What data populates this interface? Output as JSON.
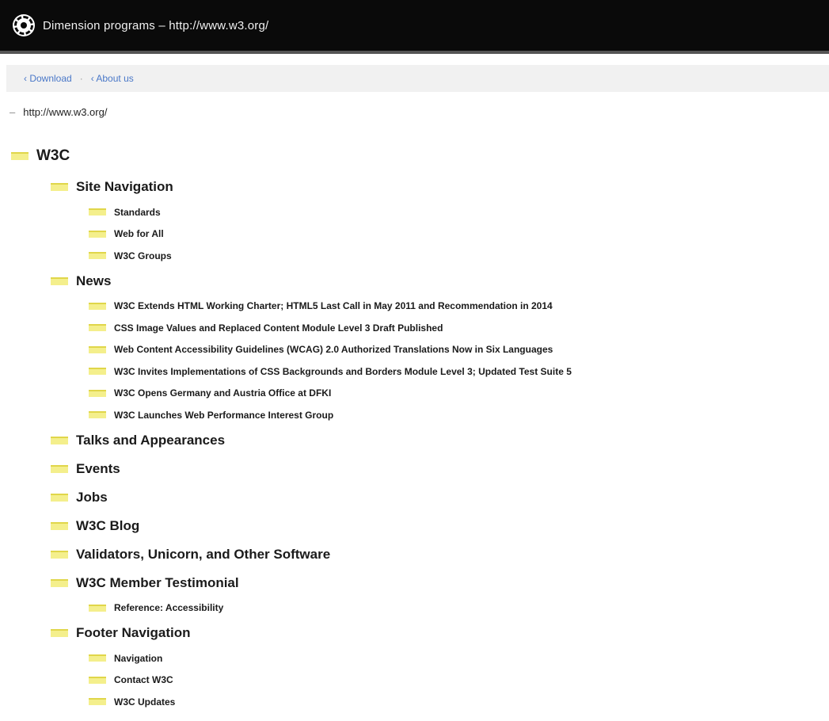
{
  "window": {
    "title": "Dimension programs – http://www.w3.org/"
  },
  "nav": {
    "download": "‹ Download",
    "sep": "·",
    "about": "‹ About us"
  },
  "page": {
    "url": "http://www.w3.org/"
  },
  "tree": [
    {
      "level": 0,
      "label": "W3C"
    },
    {
      "level": 1,
      "label": "Site Navigation"
    },
    {
      "level": 2,
      "label": "Standards"
    },
    {
      "level": 2,
      "label": "Web for All"
    },
    {
      "level": 2,
      "label": "W3C Groups"
    },
    {
      "level": 1,
      "label": "News"
    },
    {
      "level": 2,
      "label": "W3C Extends HTML Working Charter; HTML5 Last Call in May 2011 and Recommendation in 2014"
    },
    {
      "level": 2,
      "label": "CSS Image Values and Replaced Content Module Level 3 Draft Published"
    },
    {
      "level": 2,
      "label": "Web Content Accessibility Guidelines (WCAG) 2.0 Authorized Translations Now in Six Languages"
    },
    {
      "level": 2,
      "label": "W3C Invites Implementations of CSS Backgrounds and Borders Module Level 3; Updated Test Suite 5"
    },
    {
      "level": 2,
      "label": "W3C Opens Germany and Austria Office at DFKI"
    },
    {
      "level": 2,
      "label": "W3C Launches Web Performance Interest Group"
    },
    {
      "level": 1,
      "label": "Talks and Appearances"
    },
    {
      "level": 1,
      "label": "Events"
    },
    {
      "level": 1,
      "label": "Jobs"
    },
    {
      "level": 1,
      "label": "W3C Blog"
    },
    {
      "level": 1,
      "label": "Validators, Unicorn, and Other Software"
    },
    {
      "level": 1,
      "label": "W3C Member Testimonial"
    },
    {
      "level": 2,
      "label": "Reference: Accessibility"
    },
    {
      "level": 1,
      "label": "Footer Navigation"
    },
    {
      "level": 2,
      "label": "Navigation"
    },
    {
      "level": 2,
      "label": "Contact W3C"
    },
    {
      "level": 2,
      "label": "W3C Updates"
    }
  ]
}
